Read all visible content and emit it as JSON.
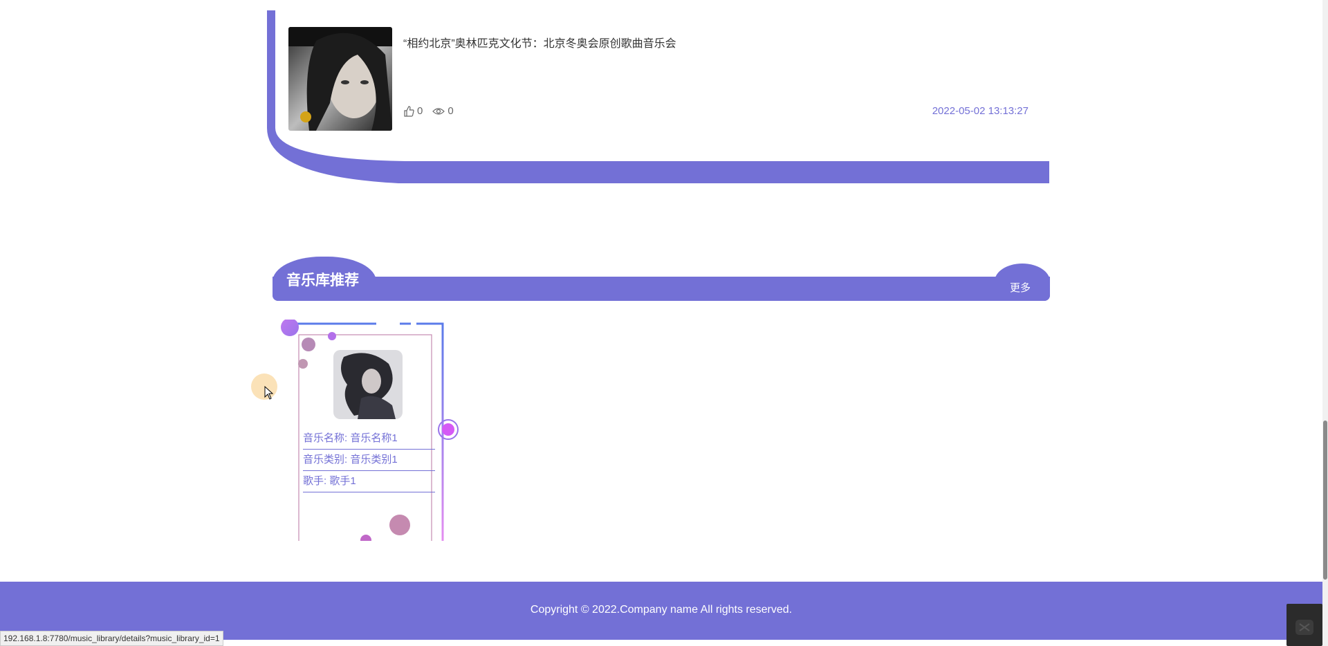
{
  "news": {
    "title": "“相约北京”奥林匹克文化节：北京冬奥会原创歌曲音乐会",
    "likes": "0",
    "views": "0",
    "date": "2022-05-02 13:13:27",
    "icons": {
      "like": "thumbs-up-icon",
      "view": "eye-icon"
    }
  },
  "section": {
    "title": "音乐库推荐",
    "more_label": "更多"
  },
  "music_card": {
    "name_line": "音乐名称: 音乐名称1",
    "type_line": "音乐类别: 音乐类别1",
    "singer_line": "歌手: 歌手1"
  },
  "footer": {
    "copyright": "Copyright © 2022.Company name All rights reserved."
  },
  "status_bar": {
    "url": "192.168.1.8:7780/music_library/details?music_library_id=1"
  },
  "colors": {
    "accent": "#7370d6",
    "text": "#333333",
    "cursor_highlight": "#fbe2b8"
  }
}
